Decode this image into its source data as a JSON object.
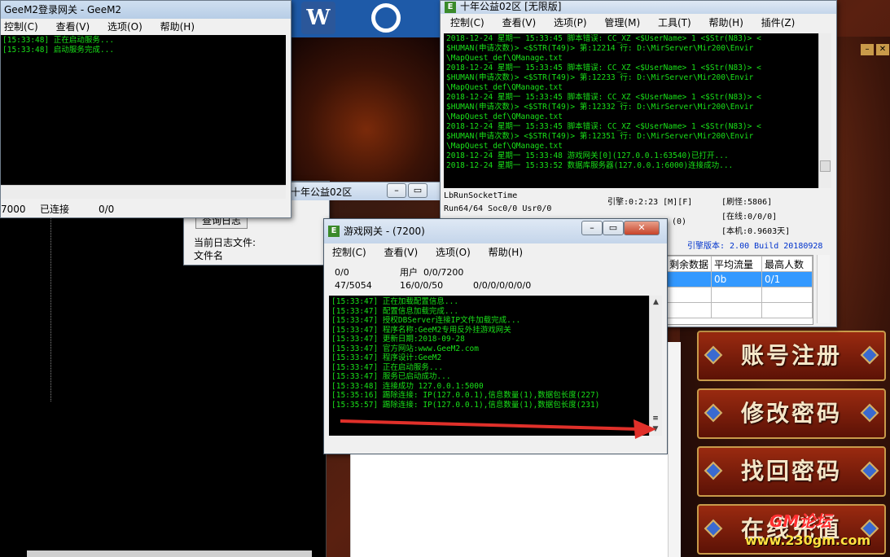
{
  "desktop": {
    "word_icon_letter": "W",
    "watermark_site": "www.230gm.com",
    "watermark_text": "GM论坛"
  },
  "login_window": {
    "title": "GeeM2登录网关 - GeeM2",
    "menu": [
      "控制(C)",
      "查看(V)",
      "选项(O)",
      "帮助(H)"
    ],
    "log": [
      "[15:33:48] 正在启动服务...",
      "[15:33:48] 启动服务完成..."
    ],
    "status": [
      "7000",
      "已连接",
      "0/0"
    ]
  },
  "db_window": {
    "title": "十年公益02区",
    "log_button": "查询日志",
    "label_current_log": "当前日志文件:",
    "label_filename": "文件名"
  },
  "m2_window": {
    "title": "十年公益02区 [无限版]",
    "menu": [
      "控制(C)",
      "查看(V)",
      "选项(P)",
      "管理(M)",
      "工具(T)",
      "帮助(H)",
      "插件(Z)"
    ],
    "log": [
      "2018-12-24 星期一 15:33:45 脚本错误: CC_XZ <$UserName> 1 <$Str(N83)> <",
      "$HUMAN(申请次数)> <$STR(T49)> 第:12214 行: D:\\MirServer\\Mir200\\Envir",
      "\\MapQuest_def\\QManage.txt",
      "2018-12-24 星期一 15:33:45 脚本错误: CC_XZ <$UserName> 1 <$Str(N83)> <",
      "$HUMAN(申请次数)> <$STR(T49)> 第:12233 行: D:\\MirServer\\Mir200\\Envir",
      "\\MapQuest_def\\QManage.txt",
      "2018-12-24 星期一 15:33:45 脚本错误: CC_XZ <$UserName> 1 <$Str(N83)> <",
      "$HUMAN(申请次数)> <$STR(T49)> 第:12332 行: D:\\MirServer\\Mir200\\Envir",
      "\\MapQuest_def\\QManage.txt",
      "2018-12-24 星期一 15:33:45 脚本错误: CC_XZ <$UserName> 1 <$Str(N83)> <",
      "$HUMAN(申请次数)> <$STR(T49)> 第:12351 行: D:\\MirServer\\Mir200\\Envir",
      "\\MapQuest_def\\QManage.txt",
      "2018-12-24 星期一 15:33:48 游戏网关[0](127.0.0.1:63540)已打开...",
      "2018-12-24 星期一 15:33:52 数据库服务器(127.0.0.1:6000)连接成功..."
    ],
    "socket_time": "LbRunSocketTime",
    "run_info": "Run64/64 Soc0/0 Usr0/0",
    "engine": "引擎:0:2:23 [M][F]",
    "refresh_monsters": "[刷怪:5806]",
    "online": "[在线:0/0/0]",
    "local": "[本机:0.9603天]",
    "engine_version": "引擎版本: 2.00 Build 20180928",
    "table_headers": [
      "剩余数据",
      "平均流量",
      "最高人数"
    ],
    "table_row": [
      "",
      "0b",
      "0/1"
    ],
    "partial_status": "(0)"
  },
  "gate_window": {
    "title": "游戏网关 - (7200)",
    "menu": [
      "控制(C)",
      "查看(V)",
      "选项(O)",
      "帮助(H)"
    ],
    "stats": {
      "a": "0/0",
      "users_label": "用户",
      "users": "0/0/7200",
      "b": "47/5054",
      "c": "16/0/0/50",
      "d": "0/0/0/0/0/0/0"
    },
    "log": [
      "[15:33:47] 正在加载配置信息...",
      "[15:33:47] 配置信息加载完成...",
      "[15:33:47] 授权DBServer连接IP文件加载完成...",
      "[15:33:47] 程序名称:GeeM2专用反外挂游戏网关",
      "[15:33:47] 更新日期:2018-09-28",
      "[15:33:47] 官方网站:www.GeeM2.com",
      "[15:33:47] 程序设计:GeeM2",
      "[15:33:47] 正在启动服务...",
      "[15:33:47] 服务已启动成功...",
      "[15:33:48] 连接成功 127.0.0.1:5000",
      "[15:35:16] 踢除连接: IP(127.0.0.1),信息数量(1),数据包长度(227)",
      "[15:35:57] 踢除连接: IP(127.0.0.1),信息数量(1),数据包长度(231)"
    ]
  },
  "game_menu": {
    "register": "账号注册",
    "change_password": "修改密码",
    "recover_password": "找回密码",
    "fourth": "在线充值"
  },
  "colors": {
    "console_text": "#19e019",
    "arrow": "#e0302a",
    "engine_version": "#0033cc"
  }
}
